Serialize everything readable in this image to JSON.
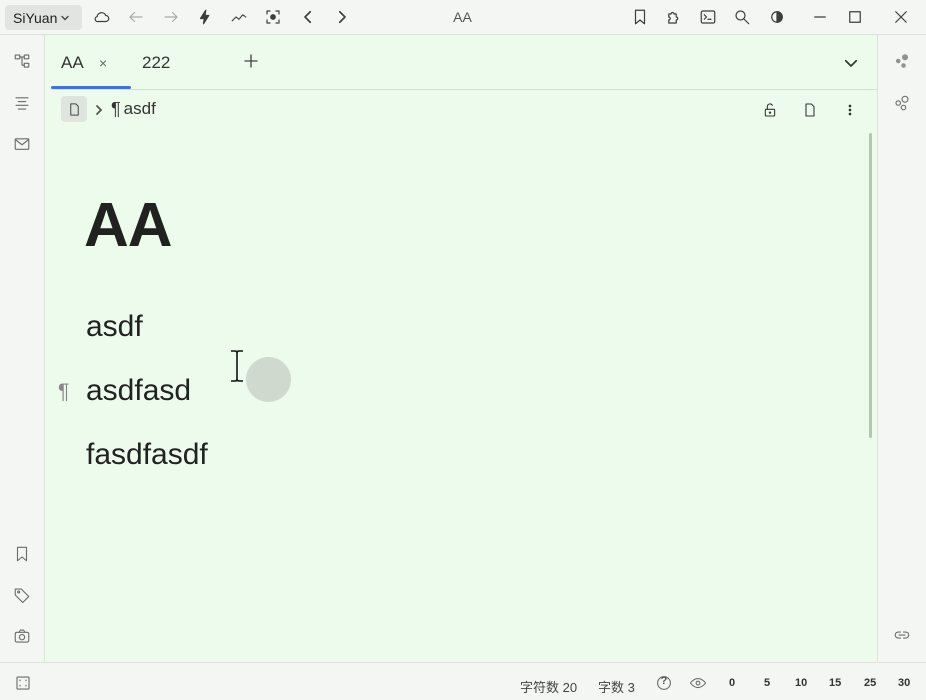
{
  "topbar": {
    "workspace": "SiYuan",
    "window_title": "AA",
    "icons": [
      "cloud-icon",
      "back-icon",
      "forward-icon",
      "lightning-icon",
      "graph-trend-icon",
      "focus-icon",
      "prev-icon",
      "next-icon",
      "bookmark-icon",
      "plugin-icon",
      "terminal-icon",
      "search-icon",
      "theme-icon",
      "minimize-icon",
      "maximize-icon",
      "close-icon"
    ]
  },
  "left_dock": {
    "icons": [
      "file-tree-icon",
      "outline-icon",
      "inbox-icon",
      "bookmark-icon",
      "tag-icon",
      "snapshot-icon"
    ]
  },
  "right_dock": {
    "icons": [
      "graph-icon",
      "global-graph-icon",
      "backlink-icon"
    ]
  },
  "tabs": [
    {
      "label": "AA",
      "active": true,
      "close": "×"
    },
    {
      "label": "222",
      "active": false
    }
  ],
  "breadcrumb": {
    "pilcrow": "¶",
    "block": "asdf"
  },
  "document": {
    "title": "AA",
    "paragraphs": [
      "asdf",
      "asdfasd",
      "fasdfasdf"
    ],
    "block_mark": "¶"
  },
  "status": {
    "char_count": "字符数 20",
    "word_count": "字数 3",
    "help": "?",
    "zoom_ticks": [
      "0",
      "5",
      "10",
      "15",
      "25",
      "30"
    ]
  },
  "colors": {
    "background": "#edfbec",
    "accent": "#3574f0"
  }
}
